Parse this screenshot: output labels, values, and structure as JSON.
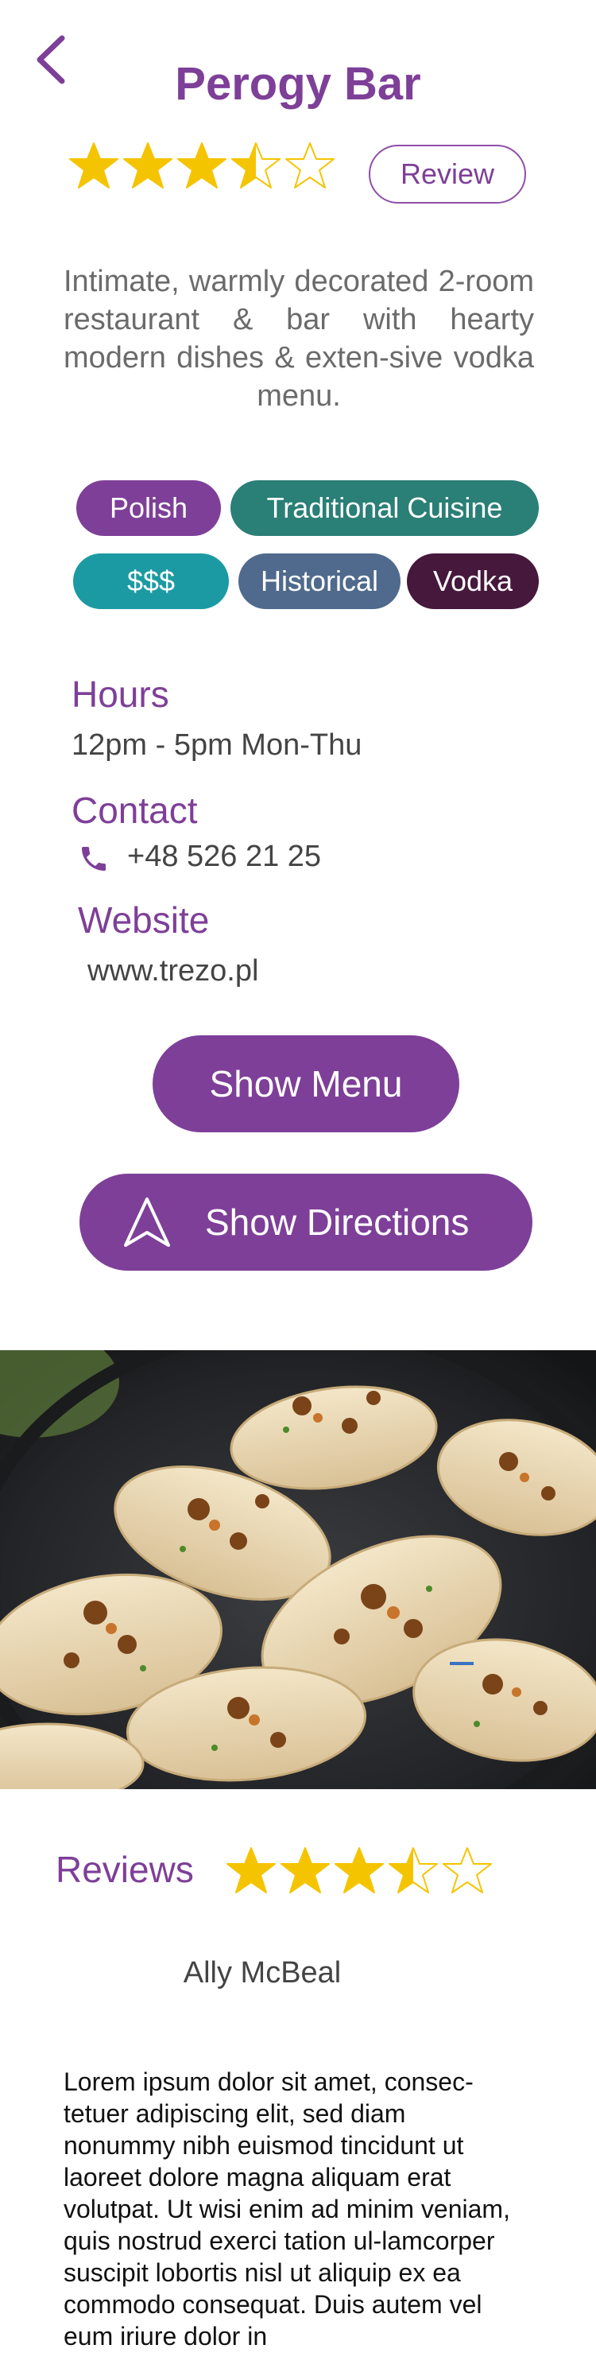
{
  "header": {
    "title": "Perogy Bar"
  },
  "rating": {
    "value": 3.5,
    "max": 5
  },
  "review_button": {
    "label": "Review"
  },
  "description": "Intimate, warmly decorated 2-room restaurant & bar with hearty modern dishes & exten-sive vodka menu.",
  "tags": [
    {
      "label": "Polish",
      "color": "#7e3f98"
    },
    {
      "label": "Traditional Cuisine",
      "color": "#2a7f76"
    },
    {
      "label": "$$$",
      "color": "#1c9aa3"
    },
    {
      "label": "Historical",
      "color": "#4f6a8c"
    },
    {
      "label": "Vodka",
      "color": "#45183c"
    }
  ],
  "hours": {
    "heading": "Hours",
    "value": "12pm - 5pm Mon-Thu"
  },
  "contact": {
    "heading": "Contact",
    "phone": "+48 526 21 25"
  },
  "website": {
    "heading": "Website",
    "url": "www.trezo.pl"
  },
  "buttons": {
    "show_menu": "Show Menu",
    "show_directions": "Show Directions"
  },
  "reviews": {
    "heading": "Reviews",
    "reviewer": "Ally McBeal",
    "text": "Lorem ipsum dolor sit amet, consec-tetuer adipiscing elit, sed diam nonummy nibh euismod tincidunt ut laoreet dolore magna aliquam erat volutpat. Ut wisi enim ad minim veniam, quis nostrud exerci tation ul-lamcorper suscipit lobortis nisl ut aliquip ex ea commodo consequat. Duis autem vel eum iriure dolor in"
  },
  "colors": {
    "accent": "#7e3f98",
    "star": "#f5c400"
  },
  "icons": {
    "back": "chevron-left-icon",
    "phone": "phone-icon",
    "directions": "navigation-arrow-icon"
  }
}
